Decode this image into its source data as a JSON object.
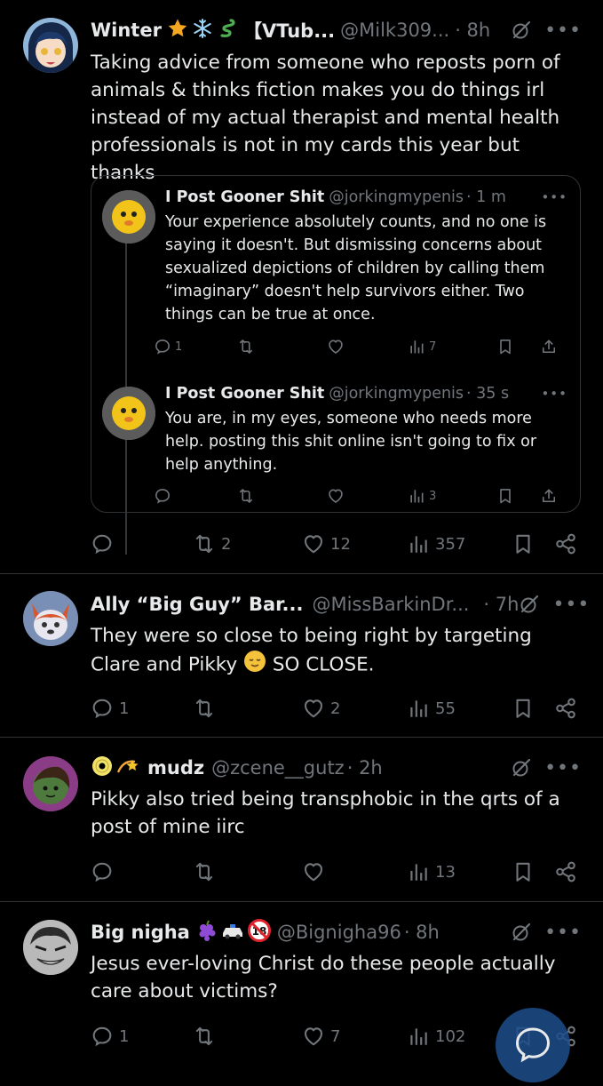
{
  "tweets": [
    {
      "name": "Winter",
      "name_suffix": "【VTub...",
      "handle": "@Milk309...",
      "time": "· 8h",
      "text": "Taking advice from someone who reposts porn of animals & thinks fiction makes you do things irl instead of my actual therapist and mental health professionals is not in my cards this year but thanks",
      "replies": "",
      "retweets": "2",
      "likes": "12",
      "views": "357",
      "quoted": [
        {
          "name": "I Post Gooner Shit",
          "handle": "@jorkingmypenis",
          "time": "· 1 m",
          "text": "Your experience absolutely counts, and no one is saying it doesn't. But dismissing concerns about sexualized depictions of children by calling them “imaginary” doesn't help survivors either. Two things can be true at once.",
          "replies": "1",
          "views": "7"
        },
        {
          "name": "I Post Gooner Shit",
          "handle": "@jorkingmypenis",
          "time": "· 35 s",
          "text": "You are, in my eyes, someone who needs more help. posting this shit online isn't going to fix or help anything.",
          "replies": "",
          "views": "3"
        }
      ]
    },
    {
      "name": "Ally “Big Guy” Bar...",
      "handle": "@MissBarkinDr...",
      "time": "· 7h",
      "text_a": "They were so close to being right by targeting Clare and Pikky",
      "text_b": "SO CLOSE.",
      "replies": "1",
      "retweets": "",
      "likes": "2",
      "views": "55"
    },
    {
      "name": "mudz",
      "handle": "@zcene__gutz",
      "time": "· 2h",
      "text": "Pikky also tried being transphobic in the qrts of a post of mine iirc",
      "replies": "",
      "retweets": "",
      "likes": "",
      "views": "13"
    },
    {
      "name": "Big nigha",
      "badge_18": "18",
      "handle": "@Bignigha96",
      "time": "· 8h",
      "text": "Jesus ever-loving Christ do these people actually care about victims?",
      "replies": "1",
      "retweets": "",
      "likes": "7",
      "views": "102"
    }
  ],
  "icons": {
    "reply": "reply-icon",
    "retweet": "retweet-icon",
    "like": "heart-icon",
    "views": "views-icon",
    "bookmark": "bookmark-icon",
    "share": "share-icon",
    "grok": "grok-icon",
    "more": "more-icon"
  },
  "colors": {
    "background": "#000000",
    "text": "#e7e9ea",
    "muted": "#71767b",
    "border": "#2f3336"
  }
}
